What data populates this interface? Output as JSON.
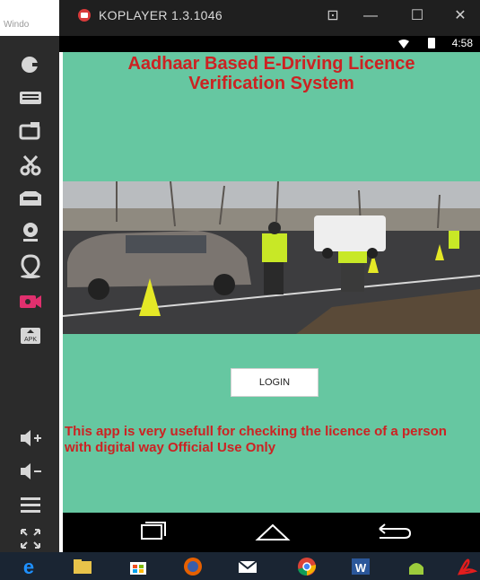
{
  "desktop": {
    "partial_label": "Windo"
  },
  "window": {
    "title": "KOPLAYER 1.3.1046",
    "controls": {
      "restore": "⊡",
      "minimize": "—",
      "maximize": "☐",
      "close": "✕"
    }
  },
  "status_bar": {
    "time": "4:58"
  },
  "sidebar": {
    "items": [
      {
        "name": "gamepad-icon"
      },
      {
        "name": "keyboard-icon"
      },
      {
        "name": "screenshot-icon"
      },
      {
        "name": "scissors-icon"
      },
      {
        "name": "folder-icon"
      },
      {
        "name": "webcam-icon"
      },
      {
        "name": "location-icon"
      },
      {
        "name": "video-record-icon"
      },
      {
        "name": "apk-install-icon"
      },
      {
        "name": "volume-up-icon"
      },
      {
        "name": "volume-down-icon"
      },
      {
        "name": "menu-icon"
      },
      {
        "name": "fullscreen-icon"
      }
    ]
  },
  "app": {
    "heading_line1": "Aadhaar Based E-Driving Licence",
    "heading_line2": "Verification System",
    "login_label": "LOGIN",
    "description": "This app is very usefull for checking the licence of a person with digital way Official Use Only",
    "colors": {
      "background": "#66c7a1",
      "text": "#cc2222"
    }
  },
  "android_nav": {
    "items": [
      "recents-icon",
      "home-icon",
      "back-icon"
    ]
  },
  "taskbar": {
    "items": [
      "ie-icon",
      "file-explorer-icon",
      "store-icon",
      "firefox-icon",
      "mail-icon",
      "chrome-icon",
      "word-icon",
      "android-icon",
      "acrobat-icon"
    ]
  }
}
